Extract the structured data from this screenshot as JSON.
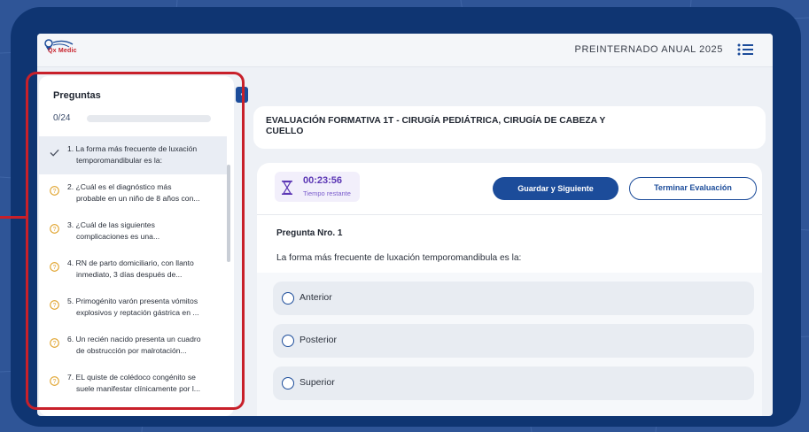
{
  "header": {
    "logo_text": "Qx Medic",
    "program": "PREINTERNADO ANUAL 2025",
    "menu_icon": "list-menu-icon"
  },
  "sidebar": {
    "title": "Preguntas",
    "progress_label": "0/24",
    "progress_fraction": 0,
    "items": [
      {
        "line1": "1. La forma más frecuente de luxación",
        "line2": "temporomandibular es la:",
        "status": "answered"
      },
      {
        "line1": "2. ¿Cuál es el diagnóstico más",
        "line2": "probable en un niño de 8 años con...",
        "status": "pending"
      },
      {
        "line1": "3. ¿Cuál de las siguientes",
        "line2": "complicaciones es una...",
        "status": "pending"
      },
      {
        "line1": "4. RN de parto domiciliario, con llanto",
        "line2": "inmediato, 3 días después de...",
        "status": "pending"
      },
      {
        "line1": "5. Primogénito varón presenta vómitos",
        "line2": "explosivos y reptación gástrica en ...",
        "status": "pending"
      },
      {
        "line1": "6. Un recién nacido presenta un cuadro",
        "line2": "de obstrucción por malrotación...",
        "status": "pending"
      },
      {
        "line1": "7. EL quiste de colédoco congénito se",
        "line2": "suele manifestar clínicamente por l...",
        "status": "pending"
      }
    ]
  },
  "evaluation": {
    "title_line1": "EVALUACIÓN FORMATIVA 1T - CIRUGÍA PEDIÁTRICA, CIRUGÍA DE CABEZA Y",
    "title_line2": "CUELLO"
  },
  "question": {
    "timer_value": "00:23:56",
    "timer_label": "Tiempo restante",
    "save_button": "Guardar y Siguiente",
    "end_button": "Terminar Evaluación",
    "number_label": "Pregunta Nro. 1",
    "statement": "La forma más frecuente de luxación temporomandibula es la:",
    "options": [
      "Anterior",
      "Posterior",
      "Superior"
    ]
  },
  "colors": {
    "frame": "#0f3572",
    "accent": "#1c4c9a",
    "highlight": "#c8202a",
    "timer": "#5b36b4",
    "pending": "#e0a22a"
  }
}
